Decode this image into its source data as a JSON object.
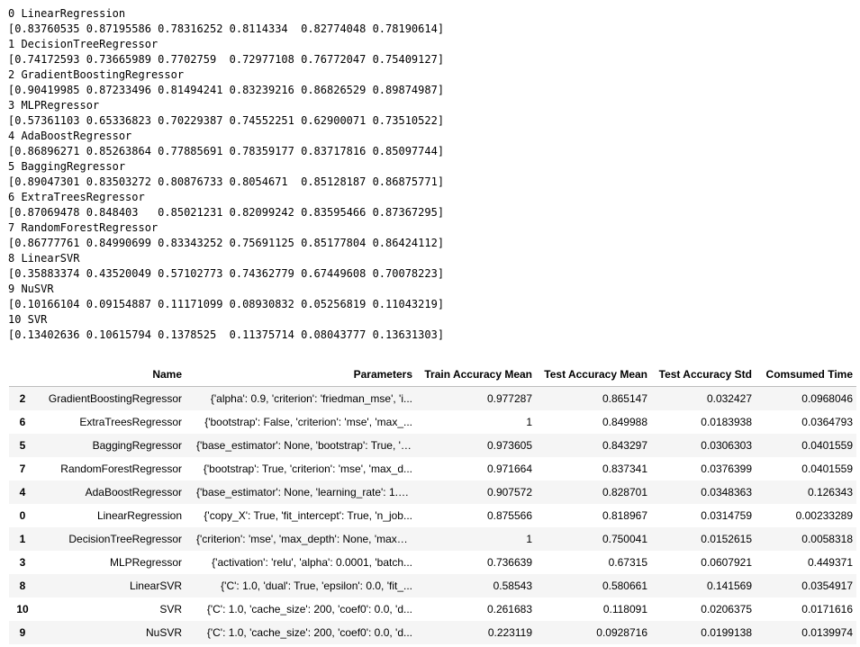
{
  "stdout_lines": [
    "0 LinearRegression",
    "[0.83760535 0.87195586 0.78316252 0.8114334  0.82774048 0.78190614]",
    "1 DecisionTreeRegressor",
    "[0.74172593 0.73665989 0.7702759  0.72977108 0.76772047 0.75409127]",
    "2 GradientBoostingRegressor",
    "[0.90419985 0.87233496 0.81494241 0.83239216 0.86826529 0.89874987]",
    "3 MLPRegressor",
    "[0.57361103 0.65336823 0.70229387 0.74552251 0.62900071 0.73510522]",
    "4 AdaBoostRegressor",
    "[0.86896271 0.85263864 0.77885691 0.78359177 0.83717816 0.85097744]",
    "5 BaggingRegressor",
    "[0.89047301 0.83503272 0.80876733 0.8054671  0.85128187 0.86875771]",
    "6 ExtraTreesRegressor",
    "[0.87069478 0.848403   0.85021231 0.82099242 0.83595466 0.87367295]",
    "7 RandomForestRegressor",
    "[0.86777761 0.84990699 0.83343252 0.75691125 0.85177804 0.86424112]",
    "8 LinearSVR",
    "[0.35883374 0.43520049 0.57102773 0.74362779 0.67449608 0.70078223]",
    "9 NuSVR",
    "[0.10166104 0.09154887 0.11171099 0.08930832 0.05256819 0.11043219]",
    "10 SVR",
    "[0.13402636 0.10615794 0.1378525  0.11375714 0.08043777 0.13631303]"
  ],
  "table": {
    "columns": [
      "",
      "Name",
      "Parameters",
      "Train Accuracy Mean",
      "Test Accuracy Mean",
      "Test Accuracy Std",
      "Comsumed Time"
    ],
    "rows": [
      {
        "index": "2",
        "name": "GradientBoostingRegressor",
        "params": "{'alpha': 0.9, 'criterion': 'friedman_mse', 'i...",
        "train_mean": "0.977287",
        "test_mean": "0.865147",
        "test_std": "0.032427",
        "time": "0.0968046"
      },
      {
        "index": "6",
        "name": "ExtraTreesRegressor",
        "params": "{'bootstrap': False, 'criterion': 'mse', 'max_...",
        "train_mean": "1",
        "test_mean": "0.849988",
        "test_std": "0.0183938",
        "time": "0.0364793"
      },
      {
        "index": "5",
        "name": "BaggingRegressor",
        "params": "{'base_estimator': None, 'bootstrap': True, 'b...",
        "train_mean": "0.973605",
        "test_mean": "0.843297",
        "test_std": "0.0306303",
        "time": "0.0401559"
      },
      {
        "index": "7",
        "name": "RandomForestRegressor",
        "params": "{'bootstrap': True, 'criterion': 'mse', 'max_d...",
        "train_mean": "0.971664",
        "test_mean": "0.837341",
        "test_std": "0.0376399",
        "time": "0.0401559"
      },
      {
        "index": "4",
        "name": "AdaBoostRegressor",
        "params": "{'base_estimator': None, 'learning_rate': 1.0,...",
        "train_mean": "0.907572",
        "test_mean": "0.828701",
        "test_std": "0.0348363",
        "time": "0.126343"
      },
      {
        "index": "0",
        "name": "LinearRegression",
        "params": "{'copy_X': True, 'fit_intercept': True, 'n_job...",
        "train_mean": "0.875566",
        "test_mean": "0.818967",
        "test_std": "0.0314759",
        "time": "0.00233289"
      },
      {
        "index": "1",
        "name": "DecisionTreeRegressor",
        "params": "{'criterion': 'mse', 'max_depth': None, 'max_f...",
        "train_mean": "1",
        "test_mean": "0.750041",
        "test_std": "0.0152615",
        "time": "0.0058318"
      },
      {
        "index": "3",
        "name": "MLPRegressor",
        "params": "{'activation': 'relu', 'alpha': 0.0001, 'batch...",
        "train_mean": "0.736639",
        "test_mean": "0.67315",
        "test_std": "0.0607921",
        "time": "0.449371"
      },
      {
        "index": "8",
        "name": "LinearSVR",
        "params": "{'C': 1.0, 'dual': True, 'epsilon': 0.0, 'fit_...",
        "train_mean": "0.58543",
        "test_mean": "0.580661",
        "test_std": "0.141569",
        "time": "0.0354917"
      },
      {
        "index": "10",
        "name": "SVR",
        "params": "{'C': 1.0, 'cache_size': 200, 'coef0': 0.0, 'd...",
        "train_mean": "0.261683",
        "test_mean": "0.118091",
        "test_std": "0.0206375",
        "time": "0.0171616"
      },
      {
        "index": "9",
        "name": "NuSVR",
        "params": "{'C': 1.0, 'cache_size': 200, 'coef0': 0.0, 'd...",
        "train_mean": "0.223119",
        "test_mean": "0.0928716",
        "test_std": "0.0199138",
        "time": "0.0139974"
      }
    ]
  }
}
